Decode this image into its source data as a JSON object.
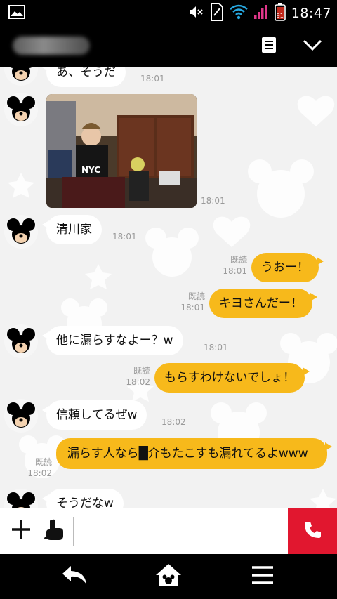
{
  "status_bar": {
    "time": "18:47",
    "battery_level": "91",
    "icons": [
      "gallery-icon",
      "mute-icon",
      "sim-icon",
      "wifi-icon",
      "signal-icon",
      "battery-icon"
    ]
  },
  "header": {
    "chat_name_redacted": true,
    "icons": [
      "notes-icon",
      "chevron-down-icon"
    ]
  },
  "messages": [
    {
      "side": "in",
      "text": "あ、そうだ",
      "time": "18:01"
    },
    {
      "side": "in",
      "type": "photo",
      "time": "18:01"
    },
    {
      "side": "in",
      "text": "清川家",
      "time": "18:01"
    },
    {
      "side": "out",
      "text": "うおー！",
      "read": "既読",
      "time": "18:01"
    },
    {
      "side": "out",
      "text": "キヨさんだー！",
      "read": "既読",
      "time": "18:01"
    },
    {
      "side": "in",
      "text": "他に漏らすなよー？w",
      "time": "18:01"
    },
    {
      "side": "out",
      "text": "もらすわけないでしょ！",
      "read": "既読",
      "time": "18:02"
    },
    {
      "side": "in",
      "text": "信頼してるぜw",
      "time": "18:02"
    },
    {
      "side": "out",
      "text": "漏らす人なら█介もたこすも漏れてるよwww",
      "read": "既読",
      "time": "18:02"
    },
    {
      "side": "in",
      "text": "そうだなw"
    }
  ],
  "input": {
    "placeholder": ""
  },
  "colors": {
    "outgoing_bubble": "#f7b91b",
    "incoming_bubble": "#ffffff",
    "call_button": "#e1172f",
    "chat_background": "#f2f2f2"
  },
  "navbar": {
    "icons": [
      "back-icon",
      "home-icon",
      "menu-icon"
    ]
  }
}
